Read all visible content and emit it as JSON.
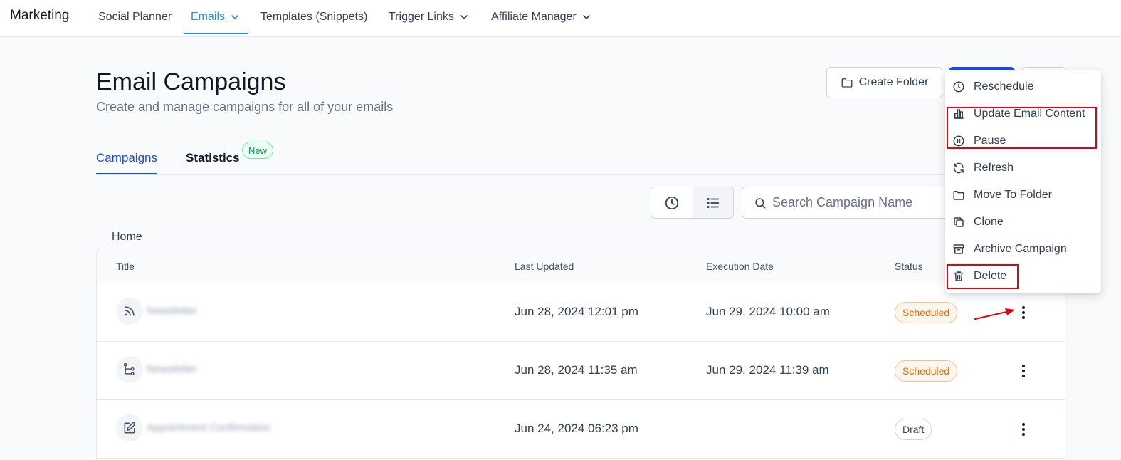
{
  "nav": {
    "brand": "Marketing",
    "items": [
      {
        "label": "Social Planner"
      },
      {
        "label": "Emails"
      },
      {
        "label": "Templates (Snippets)"
      },
      {
        "label": "Trigger Links"
      },
      {
        "label": "Affiliate Manager"
      }
    ],
    "active": "Emails"
  },
  "header": {
    "title": "Email Campaigns",
    "subtitle": "Create and manage campaigns for all of your emails",
    "create_folder_label": "Create Folder"
  },
  "tabs": [
    {
      "label": "Campaigns"
    },
    {
      "label": "Statistics",
      "badge": "New"
    }
  ],
  "search": {
    "placeholder": "Search Campaign Name"
  },
  "breadcrumb": "Home",
  "table": {
    "columns": [
      "Title",
      "Last Updated",
      "Execution Date",
      "Status"
    ],
    "rows": [
      {
        "icon": "rss-icon",
        "title": "Newsletter",
        "last_updated": "Jun 28, 2024 12:01 pm",
        "execution_date": "Jun 29, 2024 10:00 am",
        "status": "Scheduled"
      },
      {
        "icon": "workflow-icon",
        "title": "Newsletter",
        "last_updated": "Jun 28, 2024 11:35 am",
        "execution_date": "Jun 29, 2024 11:39 am",
        "status": "Scheduled"
      },
      {
        "icon": "edit-icon",
        "title": "Appointment Confirmation",
        "last_updated": "Jun 24, 2024 06:23 pm",
        "execution_date": "",
        "status": "Draft"
      }
    ]
  },
  "menu": {
    "items": [
      {
        "label": "Reschedule",
        "icon": "clock-icon"
      },
      {
        "label": "Update Email Content",
        "icon": "chart-icon"
      },
      {
        "label": "Pause",
        "icon": "pause-icon"
      },
      {
        "label": "Refresh",
        "icon": "refresh-icon"
      },
      {
        "label": "Move To Folder",
        "icon": "folder-icon"
      },
      {
        "label": "Clone",
        "icon": "copy-icon"
      },
      {
        "label": "Archive Campaign",
        "icon": "archive-icon"
      },
      {
        "label": "Delete",
        "icon": "trash-icon"
      }
    ]
  },
  "colors": {
    "accent": "#1d4ed8",
    "nav_active": "#2d8fd5",
    "annotation": "#e3000f",
    "scheduled": "#e06c00"
  }
}
